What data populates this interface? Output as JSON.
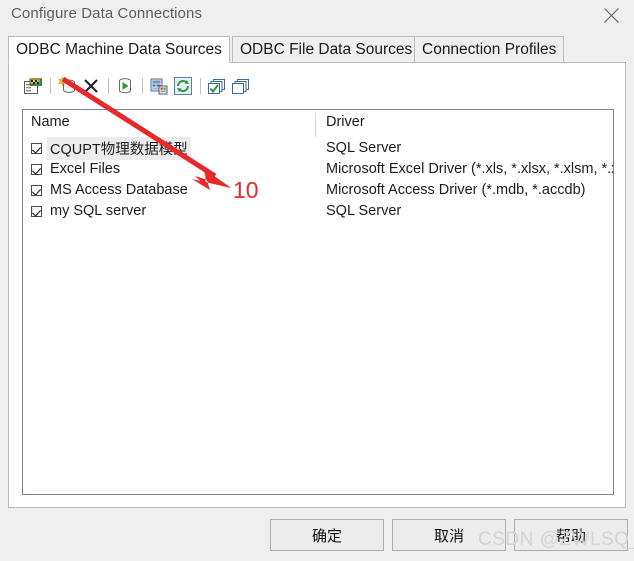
{
  "window": {
    "title": "Configure Data Connections",
    "close_icon": "close-icon"
  },
  "tabs": [
    {
      "label": "ODBC Machine Data Sources",
      "selected": true
    },
    {
      "label": "ODBC File Data Sources",
      "selected": false
    },
    {
      "label": "Connection Profiles",
      "selected": false
    }
  ],
  "toolbar": {
    "buttons": [
      {
        "name": "edit-data-source-icon",
        "title": "Edit Data Source"
      },
      {
        "name": "add-data-source-icon",
        "title": "Add Data Source"
      },
      {
        "name": "delete-data-source-icon",
        "title": "Delete Data Source"
      },
      {
        "name": "connect-data-source-icon",
        "title": "Connect"
      },
      {
        "name": "server-properties-icon",
        "title": "Properties"
      },
      {
        "name": "refresh-icon",
        "title": "Refresh"
      },
      {
        "name": "select-all-icon",
        "title": "Select All"
      },
      {
        "name": "deselect-all-icon",
        "title": "Deselect All"
      }
    ]
  },
  "list": {
    "columns": [
      "Name",
      "Driver"
    ],
    "rows": [
      {
        "checked": true,
        "name": "CQUPT物理数据模型",
        "driver": "SQL Server",
        "selected": true
      },
      {
        "checked": true,
        "name": "Excel Files",
        "driver": "Microsoft Excel Driver (*.xls, *.xlsx, *.xlsm, *.xlsb)",
        "selected": false
      },
      {
        "checked": true,
        "name": "MS Access Database",
        "driver": "Microsoft Access Driver (*.mdb, *.accdb)",
        "selected": false
      },
      {
        "checked": true,
        "name": "my SQL server",
        "driver": "SQL Server",
        "selected": false
      }
    ]
  },
  "annotation": {
    "number": "10",
    "arrow_color": "#e8282b"
  },
  "footer": {
    "ok_label": "确定",
    "cancel_label": "取消",
    "help_label": "帮助"
  },
  "watermark": {
    "text": "CSDN @ZWLSQ_"
  }
}
